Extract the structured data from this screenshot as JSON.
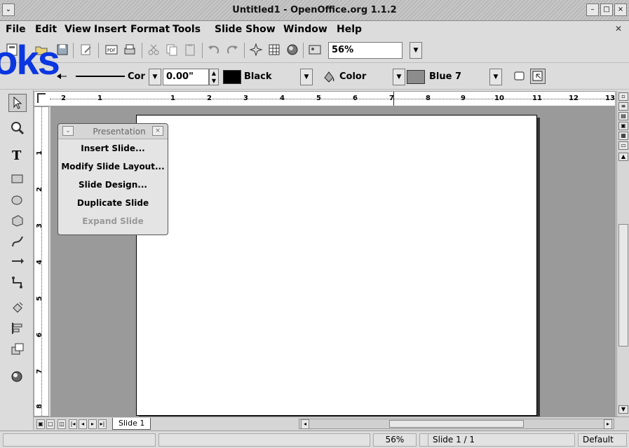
{
  "window": {
    "title": "Untitled1 - OpenOffice.org 1.1.2"
  },
  "menu": [
    {
      "label": "File"
    },
    {
      "label": "Edit"
    },
    {
      "label": "View"
    },
    {
      "label": "Insert"
    },
    {
      "label": "Format"
    },
    {
      "label": "Tools"
    },
    {
      "label": "Slide Show"
    },
    {
      "label": "Window"
    },
    {
      "label": "Help"
    }
  ],
  "toolbar": {
    "zoom_value": "56%",
    "line_style_value": "Cor",
    "line_width_value": "0.00\"",
    "line_color_value": "Black",
    "line_color_hex": "#000000",
    "area_style_value": "Color",
    "area_color_value": "Blue 7",
    "area_color_hex": "#8c8c8c"
  },
  "watermark": {
    "text": "oks",
    "color": "#0b36e0"
  },
  "ruler": {
    "horizontal": [
      "2",
      "1",
      "1",
      "2",
      "3",
      "4",
      "5",
      "6",
      "7",
      "8",
      "9",
      "10",
      "11",
      "12",
      "13"
    ],
    "vertical": [
      "1",
      "2",
      "3",
      "4",
      "5",
      "6",
      "7",
      "8"
    ]
  },
  "panel": {
    "title": "Presentation",
    "items": [
      {
        "label": "Insert Slide...",
        "enabled": true
      },
      {
        "label": "Modify Slide Layout...",
        "enabled": true
      },
      {
        "label": "Slide Design...",
        "enabled": true
      },
      {
        "label": "Duplicate Slide",
        "enabled": true
      },
      {
        "label": "Expand Slide",
        "enabled": false
      }
    ]
  },
  "tabs": [
    {
      "label": "Slide 1"
    }
  ],
  "status": {
    "zoom": "56%",
    "page": "Slide 1 / 1",
    "layout": "Default"
  }
}
